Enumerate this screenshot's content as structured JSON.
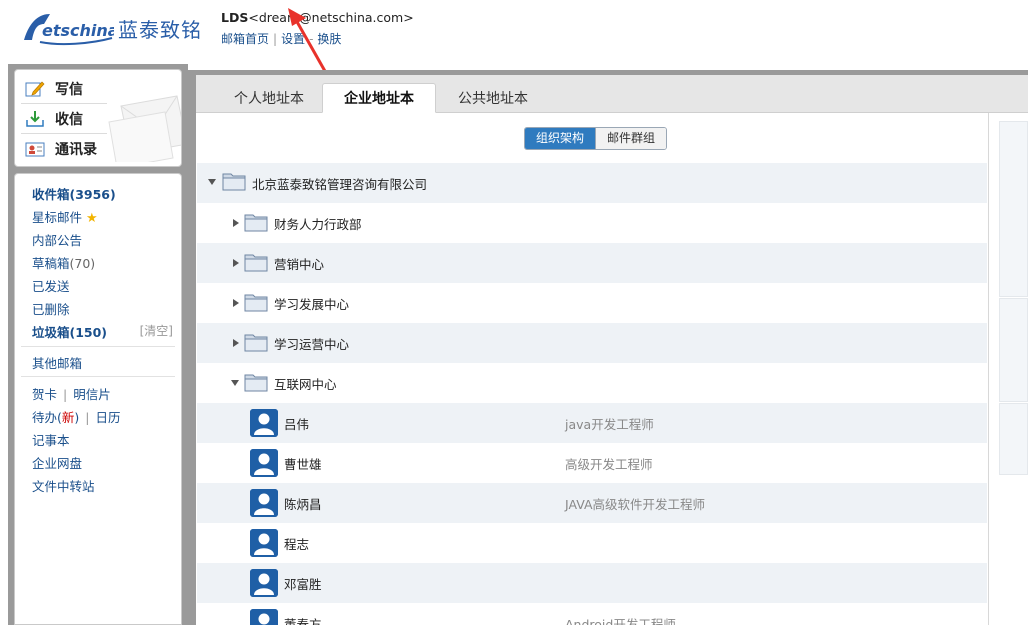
{
  "header": {
    "logo_cn": "蓝泰致铭",
    "user_name": "LDS",
    "user_email": "<dream@netschina.com>",
    "nav": [
      "邮箱首页",
      "设置",
      "换肤"
    ],
    "nav_sep": "|",
    "nav_dash": "-"
  },
  "quick": {
    "compose": "写信",
    "receive": "收信",
    "contacts": "通讯录"
  },
  "folders": {
    "inbox": "收件箱(3956)",
    "starred": "星标邮件",
    "notice": "内部公告",
    "drafts_label": "草稿箱",
    "drafts_count": "(70)",
    "sent": "已发送",
    "deleted": "已删除",
    "junk": "垃圾箱(150)",
    "junk_clear": "[清空]",
    "other": "其他邮箱",
    "card": "贺卡",
    "postcard": "明信片",
    "todo_label": "待办(",
    "todo_new": "新",
    "todo_close": ")",
    "calendar": "日历",
    "notes": "记事本",
    "netdisk": "企业网盘",
    "transfer": "文件中转站",
    "sep": "|"
  },
  "tabs": [
    "个人地址本",
    "企业地址本",
    "公共地址本"
  ],
  "segment": [
    "组织架构",
    "邮件群组"
  ],
  "tree": {
    "root": "北京蓝泰致铭管理咨询有限公司",
    "departments": [
      "财务人力行政部",
      "营销中心",
      "学习发展中心",
      "学习运营中心",
      "互联网中心"
    ],
    "members": [
      {
        "name": "吕伟",
        "title": "java开发工程师"
      },
      {
        "name": "曹世雄",
        "title": "高级开发工程师"
      },
      {
        "name": "陈炳昌",
        "title": "JAVA高级软件开发工程师"
      },
      {
        "name": "程志",
        "title": ""
      },
      {
        "name": "邓富胜",
        "title": ""
      },
      {
        "name": "董春方",
        "title": "Android开发工程师"
      }
    ]
  },
  "colors": {
    "brand": "#2a5ea8",
    "accent": "#2f7bbf",
    "frame": "#9a9a9a",
    "row_alt": "#eef2f6"
  }
}
